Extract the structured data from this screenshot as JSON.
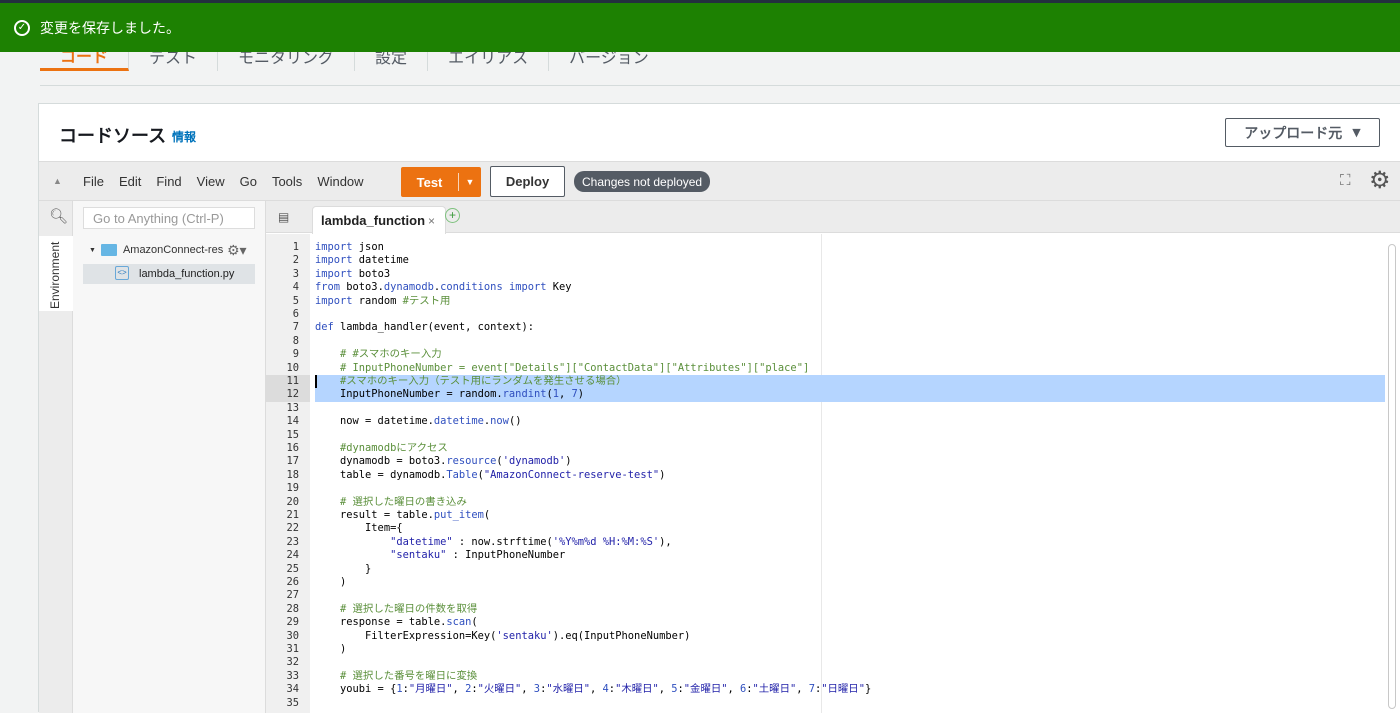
{
  "flash": {
    "message": "変更を保存しました。"
  },
  "tabs": [
    "コード",
    "テスト",
    "モニタリング",
    "設定",
    "エイリアス",
    "バージョン"
  ],
  "panel": {
    "title": "コードソース",
    "info": "情報",
    "upload_label": "アップロード元"
  },
  "menubar": {
    "items": [
      "File",
      "Edit",
      "Find",
      "View",
      "Go",
      "Tools",
      "Window"
    ],
    "test_label": "Test",
    "deploy_label": "Deploy",
    "status_badge": "Changes not deployed"
  },
  "sidebar": {
    "environment_label": "Environment",
    "goto_placeholder": "Go to Anything (Ctrl-P)",
    "folder_name": "AmazonConnect-res",
    "file_name": "lambda_function.py"
  },
  "editor": {
    "tab_label": "lambda_function",
    "lines": [
      "import json",
      "import datetime",
      "import boto3",
      "from boto3.dynamodb.conditions import Key",
      "import random #テスト用",
      "",
      "def lambda_handler(event, context):",
      "",
      "    # #スマホのキー入力",
      "    # InputPhoneNumber = event[\"Details\"][\"ContactData\"][\"Attributes\"][\"place\"]",
      "    #スマホのキー入力（テスト用にランダムを発生させる場合）",
      "    InputPhoneNumber = random.randint(1, 7)",
      "",
      "    now = datetime.datetime.now()",
      "",
      "    #dynamodbにアクセス",
      "    dynamodb = boto3.resource('dynamodb')",
      "    table = dynamodb.Table(\"AmazonConnect-reserve-test\")",
      "",
      "    # 選択した曜日の書き込み",
      "    result = table.put_item(",
      "        Item={",
      "            \"datetime\" : now.strftime('%Y%m%d %H:%M:%S'),",
      "            \"sentaku\" : InputPhoneNumber",
      "        }",
      "    )",
      "",
      "    # 選択した曜日の件数を取得",
      "    response = table.scan(",
      "        FilterExpression=Key('sentaku').eq(InputPhoneNumber)",
      "    )",
      "",
      "    # 選択した番号を曜日に変換",
      "    youbi = {1:\"月曜日\", 2:\"火曜日\", 3:\"水曜日\", 4:\"木曜日\", 5:\"金曜日\", 6:\"土曜日\", 7:\"日曜日\"}",
      ""
    ],
    "highlighted_lines": [
      11,
      12
    ]
  }
}
